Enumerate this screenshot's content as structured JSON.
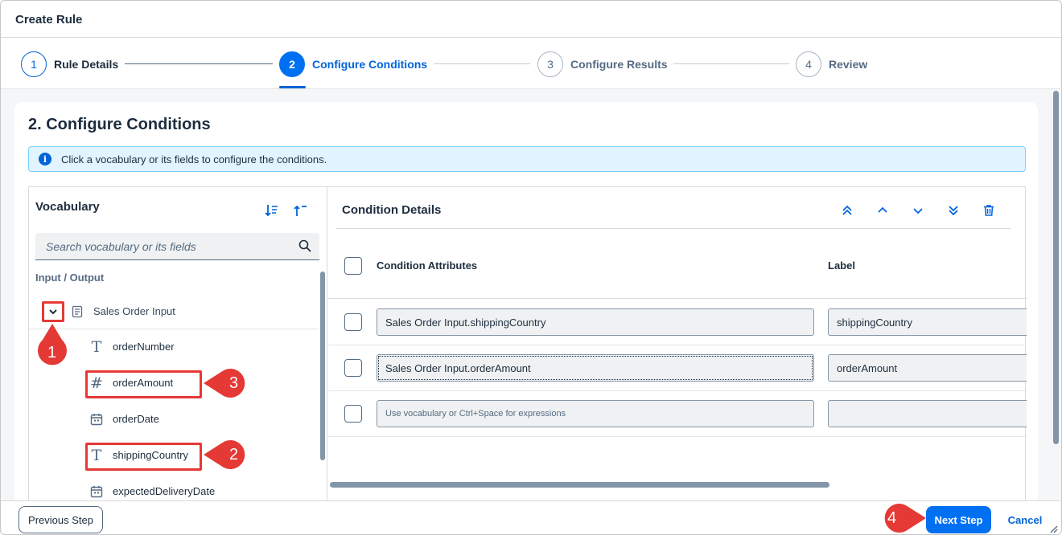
{
  "dialog": {
    "title": "Create Rule"
  },
  "wizard": {
    "steps": [
      {
        "number": "1",
        "label": "Rule Details",
        "state": "completed"
      },
      {
        "number": "2",
        "label": "Configure Conditions",
        "state": "active"
      },
      {
        "number": "3",
        "label": "Configure Results",
        "state": "inactive"
      },
      {
        "number": "4",
        "label": "Review",
        "state": "inactive"
      }
    ]
  },
  "main": {
    "heading": "2. Configure Conditions",
    "info_message": "Click a vocabulary or its fields to configure the conditions."
  },
  "vocabulary": {
    "title": "Vocabulary",
    "search_placeholder": "Search vocabulary or its fields",
    "group_label": "Input / Output",
    "root": {
      "label": "Sales Order Input",
      "icon": "structure-icon",
      "expanded": true
    },
    "fields": [
      {
        "label": "orderNumber",
        "icon": "text-type-icon"
      },
      {
        "label": "orderAmount",
        "icon": "number-type-icon"
      },
      {
        "label": "orderDate",
        "icon": "calendar-icon"
      },
      {
        "label": "shippingCountry",
        "icon": "text-type-icon"
      },
      {
        "label": "expectedDeliveryDate",
        "icon": "calendar-icon"
      }
    ]
  },
  "condition_details": {
    "title": "Condition Details",
    "columns": {
      "attributes": "Condition Attributes",
      "label": "Label"
    },
    "rows": [
      {
        "attribute": "Sales Order Input.shippingCountry",
        "label": "shippingCountry"
      },
      {
        "attribute": "Sales Order Input.orderAmount",
        "label": "orderAmount"
      },
      {
        "attribute_placeholder": "Use vocabulary or Ctrl+Space for expressions",
        "label": ""
      }
    ]
  },
  "footer": {
    "previous_label": "Previous Step",
    "next_label": "Next Step",
    "cancel_label": "Cancel"
  },
  "callouts": [
    "1",
    "2",
    "3",
    "4"
  ],
  "colors": {
    "accent": "#0070f2",
    "callout": "#e53935",
    "info_bg": "#e1f4ff"
  }
}
